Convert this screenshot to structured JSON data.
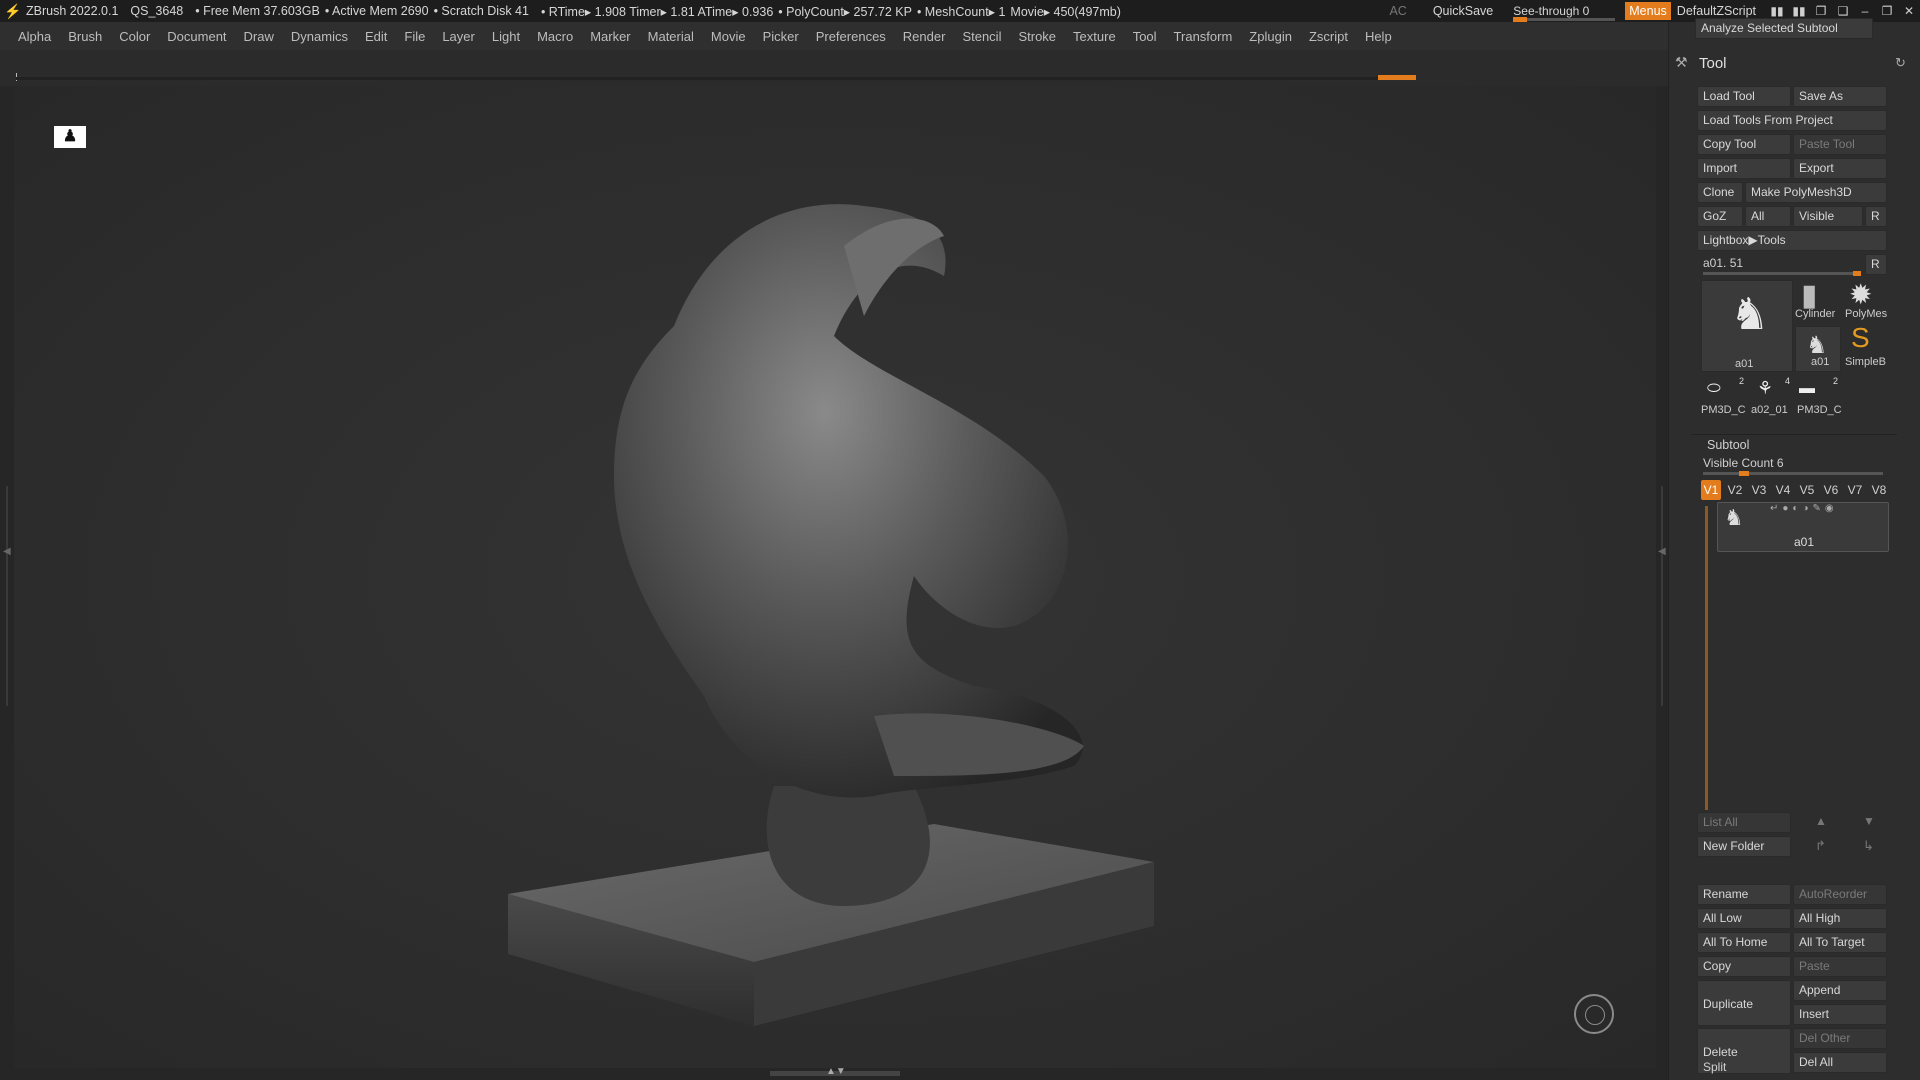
{
  "titlebar": {
    "app": "ZBrush 2022.0.1",
    "project": "QS_3648",
    "free_mem": "• Free Mem 37.603GB",
    "active_mem": "• Active Mem 2690",
    "scratch": "• Scratch Disk 41",
    "timing": "• RTime▸ 1.908 Timer▸ 1.81 ATime▸ 0.936",
    "polycount": "• PolyCount▸ 257.72 KP",
    "meshcount": "• MeshCount▸ 1",
    "movie": "Movie▸ 450(497mb)",
    "ac": "AC",
    "quicksave": "QuickSave",
    "see_through": "See-through  0",
    "menus": "Menus",
    "script": "DefaultZScript"
  },
  "menu": [
    "Alpha",
    "Brush",
    "Color",
    "Document",
    "Draw",
    "Dynamics",
    "Edit",
    "File",
    "Layer",
    "Light",
    "Macro",
    "Marker",
    "Material",
    "Movie",
    "Picker",
    "Preferences",
    "Render",
    "Stencil",
    "Stroke",
    "Texture",
    "Tool",
    "Transform",
    "Zplugin",
    "Zscript",
    "Help"
  ],
  "panel": {
    "analyze": "Analyze Selected Subtool",
    "tool_title": "Tool",
    "load_tool": "Load Tool",
    "save_as": "Save As",
    "load_from_project": "Load Tools From Project",
    "copy_tool": "Copy Tool",
    "paste_tool": "Paste Tool",
    "import": "Import",
    "export": "Export",
    "clone": "Clone",
    "make_polymesh": "Make PolyMesh3D",
    "goz": "GoZ",
    "all": "All",
    "visible": "Visible",
    "r": "R",
    "lightbox_tools": "Lightbox▶Tools",
    "current_tool": "a01. 51",
    "r2": "R",
    "thumbs": {
      "a01_big": "a01",
      "cylinder": "Cylinder",
      "polymesh": "PolyMes",
      "a01_small": "a01",
      "simpleb": "SimpleB",
      "pm3d_1": "PM3D_C",
      "pm3d_1_count": "2",
      "a02": "a02_01",
      "a02_count": "4",
      "pm3d_2": "PM3D_C",
      "pm3d_2_count": "2"
    },
    "subtool_title": "Subtool",
    "visible_count": "Visible Count 6",
    "vtabs": [
      "V1",
      "V2",
      "V3",
      "V4",
      "V5",
      "V6",
      "V7",
      "V8"
    ],
    "subtool_item": "a01",
    "list_all": "List All",
    "new_folder": "New Folder",
    "rename": "Rename",
    "autoreorder": "AutoReorder",
    "all_low": "All Low",
    "all_high": "All High",
    "all_to_home": "All To Home",
    "all_to_target": "All To Target",
    "copy": "Copy",
    "paste": "Paste",
    "duplicate": "Duplicate",
    "append": "Append",
    "insert": "Insert",
    "delete": "Delete",
    "del_other": "Del Other",
    "del_all": "Del All",
    "split": "Split"
  },
  "colors": {
    "accent": "#e37c1d",
    "bg": "#2b2b2b",
    "panel": "#2d2d2d"
  },
  "icons": {
    "doc": "figure-icon",
    "nav": "rotate-gizmo-icon"
  }
}
